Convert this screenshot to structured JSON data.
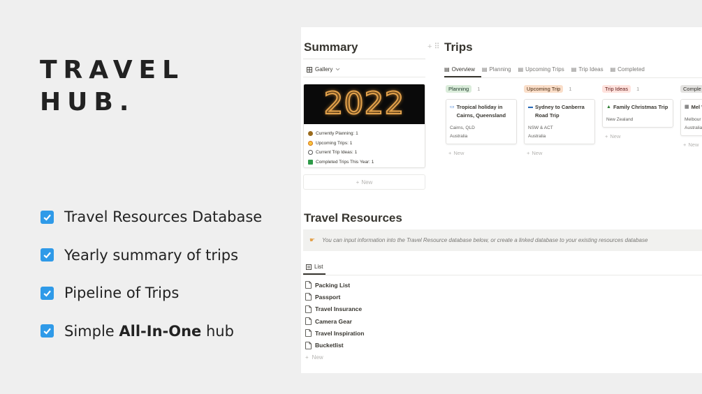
{
  "hero": {
    "title_line1": "TRAVEL",
    "title_line2": "HUB.",
    "features": [
      {
        "text": "Travel Resources Database"
      },
      {
        "text": "Yearly summary of trips"
      },
      {
        "text": "Pipeline of Trips"
      },
      {
        "prefix": "Simple ",
        "bold": "All-In-One",
        "suffix": " hub"
      }
    ]
  },
  "summary": {
    "title": "Summary",
    "view_label": "Gallery",
    "cover_text": "2022",
    "properties": [
      {
        "label": "Currently Planning: 1",
        "icon": "sun-icon",
        "color": "#9a6a1b"
      },
      {
        "label": "Upcoming Trips: 1",
        "icon": "partial-circle-icon",
        "color": "#d9730d"
      },
      {
        "label": "Current Trip Ideas: 1",
        "icon": "cloud-icon",
        "color": "#555555"
      },
      {
        "label": "Completed Trips This Year: 1",
        "icon": "checkbox-icon",
        "color": "#2e9a48"
      }
    ],
    "new_label": "New"
  },
  "trips": {
    "title": "Trips",
    "tabs": [
      "Overview",
      "Planning",
      "Upcoming Trips",
      "Trip Ideas",
      "Completed"
    ],
    "columns": [
      {
        "status": "Planning",
        "count": "1",
        "bg": "#dbeddb",
        "fg": "#1c3829",
        "card": {
          "title": "Tropical holiday in Cairns, Queensland",
          "location": "Cairns, QLD",
          "country": "Australia",
          "icon": "map-icon"
        },
        "new_label": "New"
      },
      {
        "status": "Upcoming Trip",
        "count": "1",
        "bg": "#fadec9",
        "fg": "#49290e",
        "card": {
          "title": "Sydney to Canberra Road Trip",
          "location": "NSW & ACT",
          "country": "Australia",
          "icon": "car-icon"
        },
        "new_label": "New"
      },
      {
        "status": "Trip Ideas",
        "count": "1",
        "bg": "#ffe2dd",
        "fg": "#5d1715",
        "card": {
          "title": "Family Christmas Trip",
          "location": "New Zealand",
          "country": "",
          "icon": "tree-icon"
        },
        "new_label": "New"
      },
      {
        "status": "Comple",
        "count": "",
        "bg": "#e3e2e0",
        "fg": "#32302c",
        "card": {
          "title": "Mel Weeke",
          "location": "Melbour",
          "country": "Australia",
          "icon": "building-icon"
        },
        "new_label": "New"
      }
    ]
  },
  "resources": {
    "title": "Travel Resources",
    "callout": "You can input information into the Travel Resource database below, or create a linked database to your existing resources database",
    "callout_icon": "pointing-hand-icon",
    "view_label": "List",
    "items": [
      "Packing List",
      "Passport",
      "Travel Insurance",
      "Camera Gear",
      "Travel Inspiration",
      "Bucketlist"
    ],
    "new_label": "New"
  }
}
